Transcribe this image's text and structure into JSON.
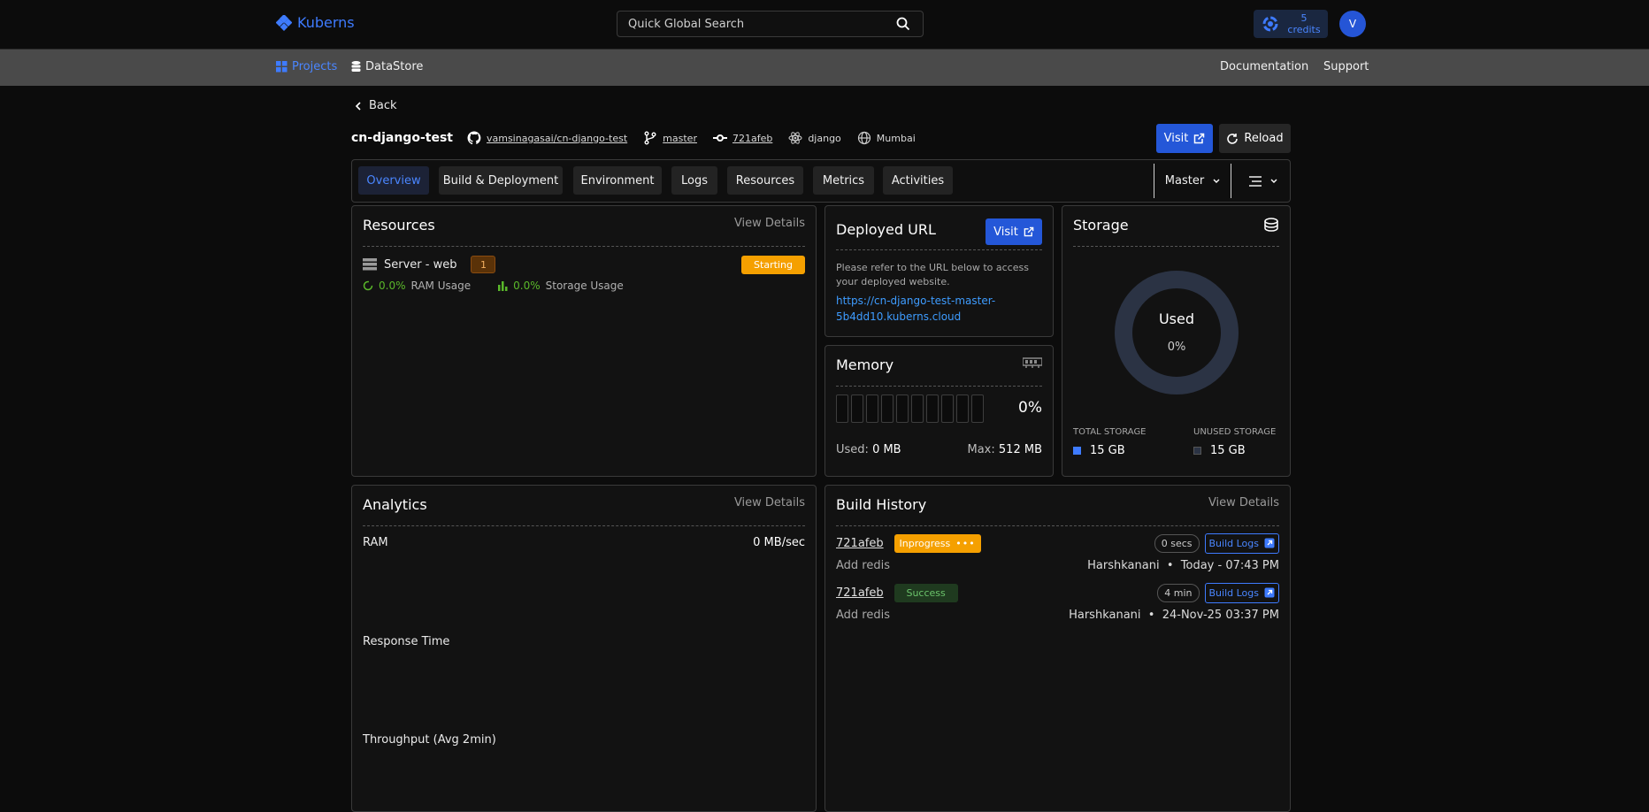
{
  "app": {
    "brand": "Kuberns"
  },
  "search": {
    "placeholder": "Quick Global Search"
  },
  "credits": {
    "count": "5",
    "label": "credits"
  },
  "user": {
    "initial": "V"
  },
  "subnav": {
    "projects": "Projects",
    "datastore": "DataStore",
    "docs": "Documentation",
    "support": "Support"
  },
  "back_label": "Back",
  "project": {
    "name": "cn-django-test",
    "repo": "vamsinagasai/cn-django-test",
    "branch": "master",
    "commit": "721afeb",
    "framework": "django",
    "region": "Mumbai"
  },
  "actions": {
    "visit": "Visit",
    "reload": "Reload"
  },
  "tabs": [
    "Overview",
    "Build & Deployment",
    "Environment",
    "Logs",
    "Resources",
    "Metrics",
    "Activities"
  ],
  "branch_selector": "Master",
  "resources": {
    "title": "Resources",
    "view_details": "View Details",
    "server": "Server - web",
    "count": "1",
    "status": "Starting",
    "ram_pct": "0.0%",
    "ram_label": "RAM Usage",
    "storage_pct": "0.0%",
    "storage_label": "Storage Usage"
  },
  "deployed": {
    "title": "Deployed URL",
    "visit": "Visit",
    "text": "Please refer to the URL below to access your deployed website.",
    "url": "https://cn-django-test-master-5b4dd10.kuberns.cloud"
  },
  "memory": {
    "title": "Memory",
    "percent": "0%",
    "used_label": "Used:",
    "used_value": "0 MB",
    "max_label": "Max:",
    "max_value": "512 MB"
  },
  "storage": {
    "title": "Storage",
    "center_label": "Used",
    "center_pct": "0%",
    "total_label": "TOTAL STORAGE",
    "total_value": "15 GB",
    "unused_label": "UNUSED STORAGE",
    "unused_value": "15 GB"
  },
  "analytics": {
    "title": "Analytics",
    "view_details": "View Details",
    "ram_label": "RAM",
    "ram_value": "0 MB/sec",
    "response_label": "Response Time",
    "throughput_label": "Throughput (Avg 2min)"
  },
  "build_history": {
    "title": "Build History",
    "view_details": "View Details",
    "builds": [
      {
        "hash": "721afeb",
        "status": "Inprogress",
        "duration": "0 secs",
        "logs": "Build Logs",
        "message": "Add redis",
        "author": "Harshkanani",
        "time": "Today - 07:43 PM"
      },
      {
        "hash": "721afeb",
        "status": "Success",
        "duration": "4 min",
        "logs": "Build Logs",
        "message": "Add redis",
        "author": "Harshkanani",
        "time": "24-Nov-25 03:37 PM"
      }
    ]
  },
  "colors": {
    "accent": "#2457d8",
    "link": "#3e9cff",
    "warning": "#f5a000",
    "success": "#5ab82a"
  }
}
